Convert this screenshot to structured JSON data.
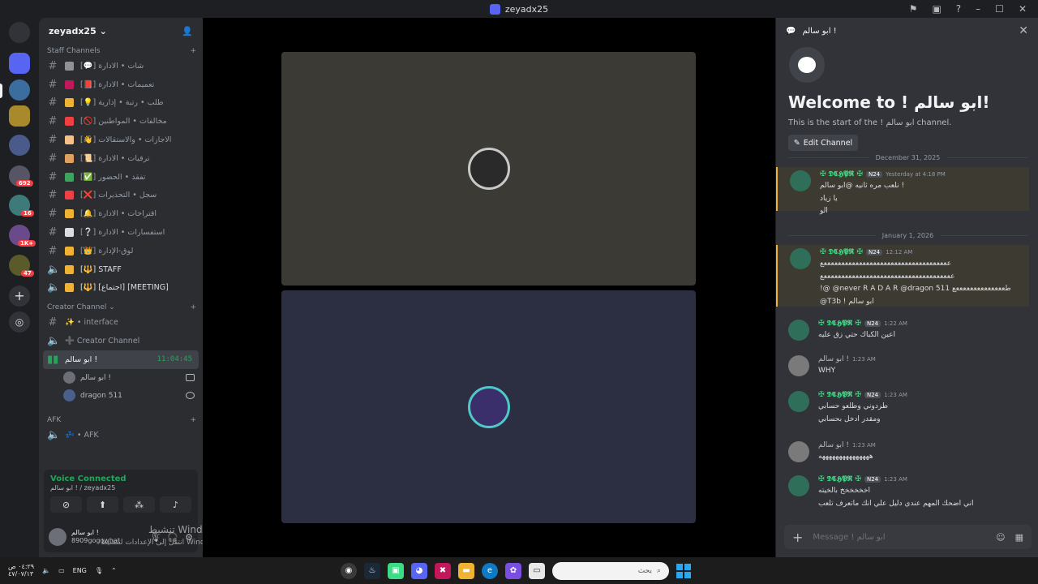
{
  "window": {
    "title": "zeyadx25",
    "controls": [
      "flag-icon",
      "inbox-icon",
      "help-icon",
      "minimize",
      "maximize",
      "close"
    ]
  },
  "rail": {
    "badges": [
      "692",
      "16",
      "1K+",
      "47"
    ],
    "colors": {
      "background": "#1e1f22",
      "badge": "#f23f43",
      "brand": "#5865f2"
    }
  },
  "server": {
    "name": "zeyadx25",
    "invite_icon": "add-member-icon"
  },
  "categories": {
    "staff": "Staff Channels",
    "creator": "Creator Channel",
    "afk": "AFK"
  },
  "staff_channels": [
    {
      "label": "[💬] شات • الادارة",
      "emo_color": "#8e9297"
    },
    {
      "label": "[📕] تعميمات • الادارة",
      "emo_color": "#c2185b"
    },
    {
      "label": "[💡] طلب • رتبة • إدارية",
      "emo_color": "#f0b232"
    },
    {
      "label": "[🚫] مخالفات • المواطنين",
      "emo_color": "#f23f43"
    },
    {
      "label": "[👋] الاجازات • والاستقالات",
      "emo_color": "#f5c28a"
    },
    {
      "label": "[📜] ترقيات • الادارة",
      "emo_color": "#e0a060"
    },
    {
      "label": "[✅] تفقد • الحضور",
      "emo_color": "#3ba55d"
    },
    {
      "label": "[❌] سجل • التحذيرات",
      "emo_color": "#f23f43"
    },
    {
      "label": "[🔔] اقتراحات • الادارة",
      "emo_color": "#f0b232"
    },
    {
      "label": "[❔] استفسارات • الادارة",
      "emo_color": "#dbdee1"
    },
    {
      "label": "[👑] لوق-الإدارة",
      "emo_color": "#f0b232"
    },
    {
      "label": "[🔱] STAFF",
      "emo_color": "#f0b232"
    },
    {
      "label": "[🔱] [اجتماع] [MEETING]",
      "emo_color": "#f0b232"
    }
  ],
  "creator_channels": [
    {
      "label": "✨ • interface"
    },
    {
      "label": "➕ Creator Channel"
    }
  ],
  "active_voice": {
    "label": "ابو سالم !",
    "timer": "11:04:45"
  },
  "voice_users": [
    {
      "name": "ابو سالم !"
    },
    {
      "name": "dragon 511"
    }
  ],
  "afk_channel": {
    "label": "💤 • AFK"
  },
  "voice_panel": {
    "status": "Voice Connected",
    "location": "ابو سالم ! / zeyadx25"
  },
  "user": {
    "display": "ابو سالم !",
    "tag": "8909gogowhat"
  },
  "activation": {
    "line1": "تنشيط Windows",
    "line2": "انتقل إلى الإعدادات لتنشيط Windows."
  },
  "chat": {
    "header": "ابو سالم !",
    "welcome_title": "Welcome to ! ابو سالم!",
    "welcome_sub": "This is the start of the ! ابو سالم channel.",
    "edit_label": "Edit Channel",
    "date1": "December 31, 2025",
    "date2": "January 1, 2026",
    "composer_placeholder": "Message ! ابو سالم",
    "messages": [
      {
        "name": "✠ 𝕯𝕮𝕳𝕻𝕽 ✠",
        "tag": "N24",
        "time": "Yesterday at 4:18 PM",
        "lines": [
          "نلعب مره ثانيه @ابو سالم !",
          "يا زياد",
          "الو"
        ]
      },
      {
        "name": "✠ 𝕯𝕮𝕳𝕻𝕽 ✠",
        "tag": "N24",
        "time": "12:12 AM",
        "lines": [
          "ععععععععععععععععععععععععععععععععععععع",
          "عععععععععععععععععععععععععععععععععععععع",
          "!@ @never R A D A R @dragon 511 طععععععععععععععع",
          "@T3b ! ابو سالم"
        ]
      },
      {
        "name": "✠ 𝕯𝕮𝕳𝕻𝕽 ✠",
        "tag": "N24",
        "time": "1:22 AM",
        "lines": [
          "اعين الكباك حتي زق عليه"
        ]
      },
      {
        "name": "ابو سالم !",
        "tag": "",
        "time": "1:23 AM",
        "lines": [
          "WHY"
        ]
      },
      {
        "name": "✠ 𝕯𝕮𝕳𝕻𝕽 ✠",
        "tag": "N24",
        "time": "1:23 AM",
        "lines": [
          "طردوني وطلعو حسابي",
          "ومقدر ادخل بحسابي"
        ]
      },
      {
        "name": "ابو سالم !",
        "tag": "",
        "time": "1:23 AM",
        "lines": [
          "هههههههههههههههه"
        ]
      },
      {
        "name": "✠ 𝕯𝕮𝕳𝕻𝕽 ✠",
        "tag": "N24",
        "time": "1:23 AM",
        "lines": [
          "اخخخخخخ بالخيته",
          "اني اضحك المهم عندي دليل علي انك ماتعرف تلعب"
        ]
      }
    ]
  },
  "taskbar": {
    "clock_time": "٠٤:٢٩ ص",
    "clock_date": "٤٧/٠٧/١٣",
    "lang": "ENG",
    "search_placeholder": "بحث"
  }
}
